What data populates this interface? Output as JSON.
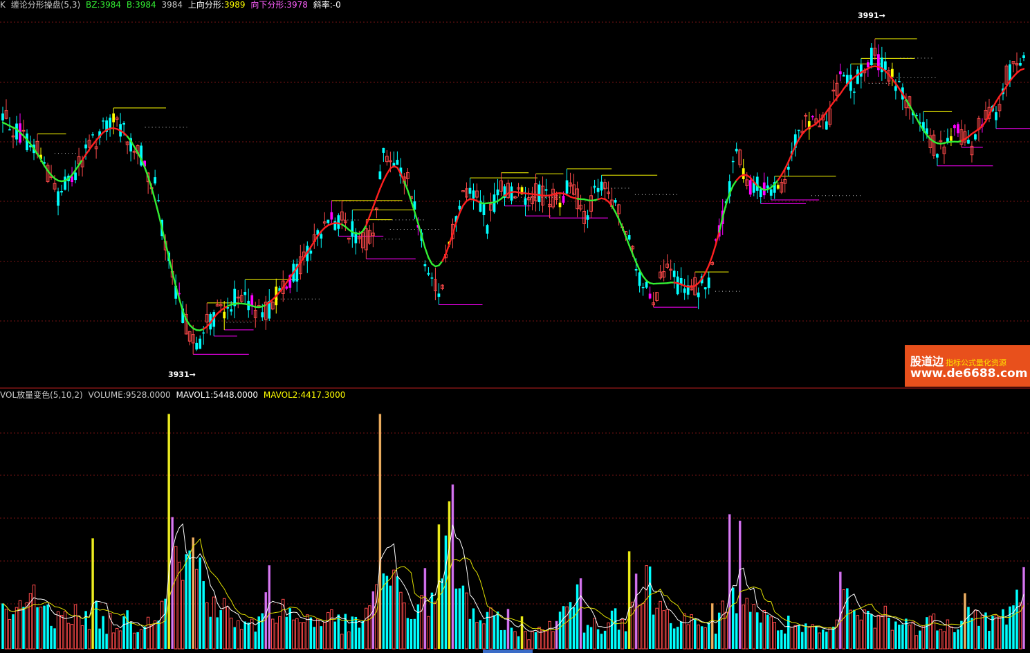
{
  "kline_header": {
    "k": "K",
    "name": "缠论分形操盘(5,3)",
    "bz": "BZ:3984",
    "b": "B:3984",
    "v": "3984",
    "up_label": "上向分形:",
    "up_value": "3989",
    "down_label": "向下分形:",
    "down_value": "3978",
    "slope": "斜率:-0"
  },
  "vol_header": {
    "name": "VOL放量变色(5,10,2)",
    "volume": "VOLUME:9528.0000",
    "mavol1": "MAVOL1:5448.0000",
    "mavol2": "MAVOL2:4417.3000"
  },
  "annotations": {
    "high": "3991→",
    "low": "3931→"
  },
  "watermark": {
    "brand": "股道边",
    "tagline": "指标公式量化资源",
    "url": "www.de6688.com"
  },
  "colors": {
    "up_candle": "#ff4a4a",
    "down_candle": "#00ffff",
    "signal_up": "#ff00ff",
    "signal_down": "#ffff00",
    "trend_up": "#ff2020",
    "trend_down": "#33ee33",
    "grid": "#7a1515",
    "fractal_top": "#ffff00",
    "fractal_bottom": "#ff00ff",
    "mavol1": "#ffffff",
    "mavol2": "#e0e000"
  },
  "chart_data": {
    "type": "candlestick+volume",
    "price_ylim": [
      3929.5,
      3992
    ],
    "price_anchors": [
      [
        0,
        3975
      ],
      [
        5,
        3972
      ],
      [
        10,
        3969
      ],
      [
        16,
        3961
      ],
      [
        22,
        3966
      ],
      [
        28,
        3972
      ],
      [
        33,
        3974
      ],
      [
        39,
        3969
      ],
      [
        44,
        3962
      ],
      [
        47,
        3952
      ],
      [
        50,
        3943
      ],
      [
        53,
        3938
      ],
      [
        56,
        3933
      ],
      [
        58,
        3937
      ],
      [
        62,
        3940
      ],
      [
        67,
        3942
      ],
      [
        72,
        3941
      ],
      [
        77,
        3940
      ],
      [
        81,
        3945
      ],
      [
        86,
        3948
      ],
      [
        90,
        3953
      ],
      [
        95,
        3957
      ],
      [
        100,
        3955
      ],
      [
        104,
        3952
      ],
      [
        107,
        3955
      ],
      [
        110,
        3969
      ],
      [
        114,
        3966
      ],
      [
        118,
        3962
      ],
      [
        122,
        3950
      ],
      [
        126,
        3943
      ],
      [
        129,
        3952
      ],
      [
        133,
        3962
      ],
      [
        137,
        3961
      ],
      [
        140,
        3956
      ],
      [
        144,
        3962
      ],
      [
        150,
        3961
      ],
      [
        156,
        3961
      ],
      [
        160,
        3960
      ],
      [
        164,
        3963
      ],
      [
        168,
        3957
      ],
      [
        172,
        3962
      ],
      [
        176,
        3960
      ],
      [
        180,
        3954
      ],
      [
        184,
        3946
      ],
      [
        188,
        3943
      ],
      [
        192,
        3947
      ],
      [
        196,
        3944
      ],
      [
        200,
        3944
      ],
      [
        204,
        3946
      ],
      [
        208,
        3956
      ],
      [
        212,
        3969
      ],
      [
        216,
        3962
      ],
      [
        220,
        3962
      ],
      [
        224,
        3961
      ],
      [
        228,
        3969
      ],
      [
        232,
        3974
      ],
      [
        238,
        3973
      ],
      [
        242,
        3982
      ],
      [
        246,
        3980
      ],
      [
        251,
        3986
      ],
      [
        256,
        3982
      ],
      [
        260,
        3980
      ],
      [
        264,
        3974
      ],
      [
        268,
        3970
      ],
      [
        272,
        3969
      ],
      [
        276,
        3972
      ],
      [
        280,
        3969
      ],
      [
        284,
        3976
      ],
      [
        287,
        3975
      ],
      [
        290,
        3982
      ],
      [
        294,
        3984
      ]
    ],
    "volume_anchors": [
      [
        0,
        4300
      ],
      [
        3,
        3000
      ],
      [
        6,
        4500
      ],
      [
        8,
        6500
      ],
      [
        11,
        4800
      ],
      [
        14,
        3200
      ],
      [
        17,
        5000
      ],
      [
        20,
        4100
      ],
      [
        23,
        2800
      ],
      [
        26,
        4200
      ],
      [
        29,
        3000
      ],
      [
        32,
        2600
      ],
      [
        35,
        3200
      ],
      [
        39,
        2900
      ],
      [
        42,
        3400
      ],
      [
        45,
        4800
      ],
      [
        47,
        6800
      ],
      [
        49,
        8600
      ],
      [
        51,
        10200
      ],
      [
        53,
        8600
      ],
      [
        55,
        10400
      ],
      [
        57,
        8400
      ],
      [
        59,
        6600
      ],
      [
        62,
        4700
      ],
      [
        65,
        3800
      ],
      [
        68,
        2800
      ],
      [
        71,
        2400
      ],
      [
        74,
        2700
      ],
      [
        77,
        3800
      ],
      [
        80,
        4500
      ],
      [
        83,
        3800
      ],
      [
        86,
        3000
      ],
      [
        89,
        3700
      ],
      [
        92,
        3000
      ],
      [
        95,
        3300
      ],
      [
        98,
        2800
      ],
      [
        101,
        2500
      ],
      [
        104,
        3100
      ],
      [
        107,
        4200
      ],
      [
        108,
        7600
      ],
      [
        110,
        9500
      ],
      [
        112,
        6600
      ],
      [
        115,
        5600
      ],
      [
        118,
        3800
      ],
      [
        121,
        5100
      ],
      [
        124,
        4600
      ],
      [
        127,
        6100
      ],
      [
        128,
        9600
      ],
      [
        130,
        10400
      ],
      [
        132,
        6000
      ],
      [
        134,
        5400
      ],
      [
        136,
        4000
      ],
      [
        139,
        3000
      ],
      [
        142,
        3300
      ],
      [
        145,
        2000
      ],
      [
        148,
        1700
      ],
      [
        151,
        1600
      ],
      [
        154,
        1400
      ],
      [
        157,
        3300
      ],
      [
        160,
        2500
      ],
      [
        162,
        3700
      ],
      [
        165,
        6000
      ],
      [
        168,
        3000
      ],
      [
        171,
        2600
      ],
      [
        174,
        3000
      ],
      [
        177,
        3800
      ],
      [
        180,
        3400
      ],
      [
        182,
        4900
      ],
      [
        184,
        4700
      ],
      [
        186,
        8000
      ],
      [
        188,
        5700
      ],
      [
        190,
        4400
      ],
      [
        193,
        4200
      ],
      [
        196,
        3500
      ],
      [
        199,
        2900
      ],
      [
        202,
        1800
      ],
      [
        205,
        2400
      ],
      [
        208,
        3800
      ],
      [
        210,
        4600
      ],
      [
        212,
        5800
      ],
      [
        214,
        7000
      ],
      [
        216,
        5200
      ],
      [
        219,
        3500
      ],
      [
        222,
        2900
      ],
      [
        225,
        2400
      ],
      [
        228,
        2800
      ],
      [
        231,
        2100
      ],
      [
        234,
        1900
      ],
      [
        237,
        1800
      ],
      [
        240,
        2000
      ],
      [
        242,
        4000
      ],
      [
        244,
        5400
      ],
      [
        246,
        3700
      ],
      [
        249,
        3600
      ],
      [
        252,
        3200
      ],
      [
        255,
        3800
      ],
      [
        258,
        2900
      ],
      [
        261,
        2600
      ],
      [
        264,
        2600
      ],
      [
        267,
        2700
      ],
      [
        270,
        3100
      ],
      [
        273,
        3100
      ],
      [
        276,
        2900
      ],
      [
        279,
        3800
      ],
      [
        282,
        3600
      ],
      [
        285,
        3100
      ],
      [
        288,
        3000
      ],
      [
        291,
        4300
      ],
      [
        293,
        5900
      ],
      [
        294,
        7200
      ]
    ],
    "volume_spikes": [
      [
        26,
        11900
      ],
      [
        48,
        25300
      ],
      [
        49,
        14200
      ],
      [
        55,
        12000
      ],
      [
        76,
        6100
      ],
      [
        77,
        9000
      ],
      [
        107,
        6200
      ],
      [
        109,
        25300
      ],
      [
        122,
        8700
      ],
      [
        126,
        13400
      ],
      [
        129,
        15900
      ],
      [
        130,
        17700
      ],
      [
        146,
        4300
      ],
      [
        150,
        3500
      ],
      [
        160,
        3000
      ],
      [
        167,
        7600
      ],
      [
        181,
        10500
      ],
      [
        183,
        8100
      ],
      [
        205,
        4900
      ],
      [
        210,
        14500
      ],
      [
        213,
        13800
      ],
      [
        242,
        8300
      ],
      [
        278,
        6000
      ],
      [
        295,
        8800
      ]
    ],
    "volume_ylim": [
      0,
      26000
    ],
    "n_bars": 296,
    "trend_switch_points": [
      [
        0,
        "down"
      ],
      [
        23,
        "up"
      ],
      [
        36,
        "down"
      ],
      [
        58,
        "up"
      ],
      [
        65,
        "down"
      ],
      [
        76,
        "up"
      ],
      [
        98,
        "down"
      ],
      [
        105,
        "up"
      ],
      [
        116,
        "down"
      ],
      [
        127,
        "up"
      ],
      [
        138,
        "down"
      ],
      [
        145,
        "up"
      ],
      [
        166,
        "down"
      ],
      [
        172,
        "up"
      ],
      [
        176,
        "down"
      ],
      [
        194,
        "up"
      ],
      [
        207,
        "down"
      ],
      [
        212,
        "up"
      ],
      [
        218,
        "down"
      ],
      [
        224,
        "up"
      ],
      [
        261,
        "down"
      ],
      [
        277,
        "up"
      ]
    ],
    "legend": "top-left",
    "grid": true
  }
}
